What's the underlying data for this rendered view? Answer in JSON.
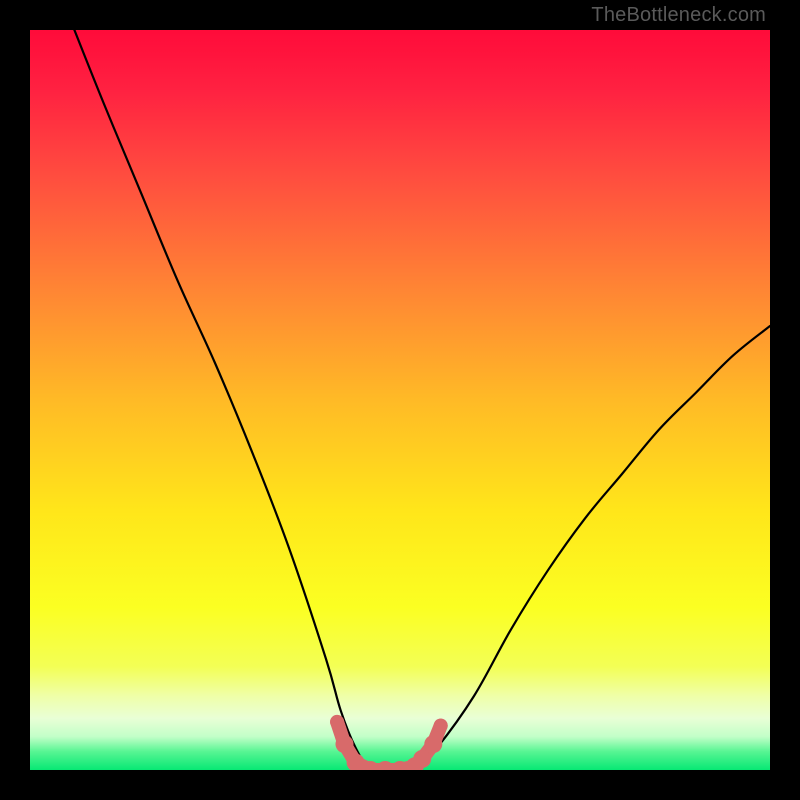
{
  "watermark": "TheBottleneck.com",
  "chart_data": {
    "type": "line",
    "title": "",
    "xlabel": "",
    "ylabel": "",
    "xlim": [
      0,
      100
    ],
    "ylim": [
      0,
      100
    ],
    "grid": false,
    "legend": false,
    "series": [
      {
        "name": "bottleneck-curve",
        "x": [
          6,
          10,
          15,
          20,
          25,
          30,
          35,
          40,
          42,
          44,
          46,
          48,
          50,
          52,
          55,
          60,
          65,
          70,
          75,
          80,
          85,
          90,
          95,
          100
        ],
        "values": [
          100,
          90,
          78,
          66,
          55,
          43,
          30,
          15,
          8,
          3,
          0,
          0,
          0,
          0,
          3,
          10,
          19,
          27,
          34,
          40,
          46,
          51,
          56,
          60
        ]
      },
      {
        "name": "trough-markers",
        "x": [
          41.5,
          42.5,
          44,
          46,
          48,
          50,
          52,
          53,
          54.5,
          55.5
        ],
        "values": [
          6.5,
          3.5,
          1,
          0,
          0,
          0,
          0.5,
          1.5,
          3.5,
          6
        ]
      }
    ],
    "gradient_stops": [
      {
        "offset": 0.0,
        "color": "#ff0b3a"
      },
      {
        "offset": 0.08,
        "color": "#ff2141"
      },
      {
        "offset": 0.2,
        "color": "#ff4e3f"
      },
      {
        "offset": 0.35,
        "color": "#ff8534"
      },
      {
        "offset": 0.5,
        "color": "#ffba26"
      },
      {
        "offset": 0.65,
        "color": "#ffe61a"
      },
      {
        "offset": 0.78,
        "color": "#fbff22"
      },
      {
        "offset": 0.86,
        "color": "#f3ff55"
      },
      {
        "offset": 0.9,
        "color": "#efffa8"
      },
      {
        "offset": 0.93,
        "color": "#e9ffd6"
      },
      {
        "offset": 0.955,
        "color": "#c2ffc8"
      },
      {
        "offset": 0.975,
        "color": "#58f593"
      },
      {
        "offset": 1.0,
        "color": "#07e874"
      }
    ],
    "marker_color": "#d86a6a",
    "curve_color": "#000000"
  }
}
